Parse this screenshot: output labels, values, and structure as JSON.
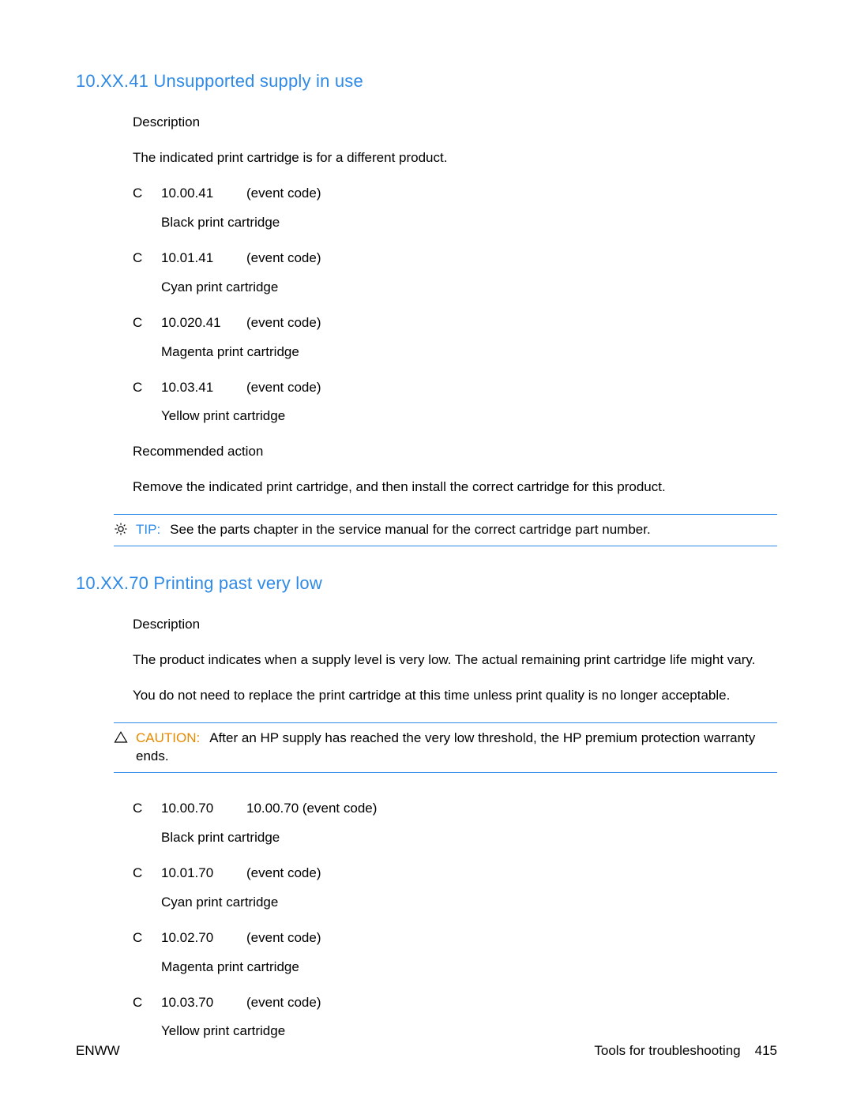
{
  "section1": {
    "heading": "10.XX.41 Unsupported supply in use",
    "description_label": "Description",
    "description_text": "The indicated print cartridge is for a different product.",
    "items": [
      {
        "bullet": "C",
        "code": "10.00.41",
        "ec": "(event code)",
        "desc": "Black print cartridge"
      },
      {
        "bullet": "C",
        "code": "10.01.41",
        "ec": "(event code)",
        "desc": "Cyan print cartridge"
      },
      {
        "bullet": "C",
        "code": "10.020.41",
        "ec": "(event code)",
        "desc": "Magenta print cartridge"
      },
      {
        "bullet": "C",
        "code": "10.03.41",
        "ec": "(event code)",
        "desc": "Yellow print cartridge"
      }
    ],
    "recommended_label": "Recommended action",
    "recommended_text": "Remove the indicated print cartridge, and then install the correct cartridge for this product.",
    "tip_label": "TIP:",
    "tip_text": "See the parts chapter in the service manual for the correct cartridge part number."
  },
  "section2": {
    "heading": "10.XX.70 Printing past very low",
    "description_label": "Description",
    "description_text1": "The product indicates when a supply level is very low. The actual remaining print cartridge life might vary.",
    "description_text2": "You do not need to replace the print cartridge at this time unless print quality is no longer acceptable.",
    "caution_label": "CAUTION:",
    "caution_text": "After an HP supply has reached the very low threshold, the HP premium protection warranty ends.",
    "items": [
      {
        "bullet": "C",
        "code": "10.00.70",
        "ec": "10.00.70 (event code)",
        "desc": "Black print cartridge"
      },
      {
        "bullet": "C",
        "code": "10.01.70",
        "ec": "(event code)",
        "desc": "Cyan print cartridge"
      },
      {
        "bullet": "C",
        "code": "10.02.70",
        "ec": "(event code)",
        "desc": "Magenta print cartridge"
      },
      {
        "bullet": "C",
        "code": "10.03.70",
        "ec": "(event code)",
        "desc": "Yellow print cartridge"
      }
    ]
  },
  "footer": {
    "left": "ENWW",
    "right_text": "Tools for troubleshooting",
    "page": "415"
  }
}
